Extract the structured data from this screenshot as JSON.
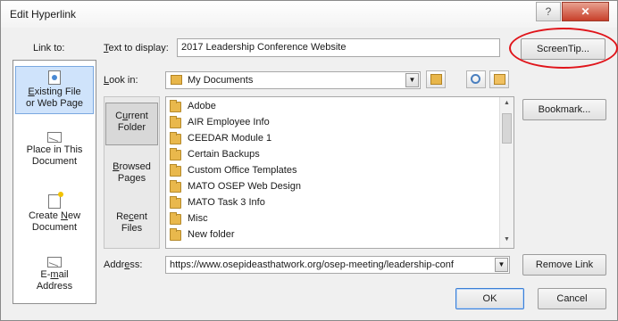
{
  "window": {
    "title": "Edit Hyperlink",
    "help_glyph": "?",
    "close_glyph": "✕"
  },
  "labels": {
    "link_to_prefix": "Link to:",
    "text_to_display_u": "T",
    "text_to_display_rest": "ext to display:",
    "look_in_u": "L",
    "look_in_rest": "ook in:",
    "address_prefix": "Addr",
    "address_u": "e",
    "address_rest": "ss:"
  },
  "text_to_display_value": "2017 Leadership Conference Website",
  "look_in_value": "My Documents",
  "address_value": "https://www.osepideasthatwork.org/osep-meeting/leadership-conf",
  "link_to": [
    {
      "line1_u": "E",
      "line1_rest": "xisting File",
      "line2": "or Web Page"
    },
    {
      "line1": "Place in This",
      "line2": "Document"
    },
    {
      "line1_pre": "Create ",
      "line1_u": "N",
      "line1_rest": "ew",
      "line2": "Document"
    },
    {
      "line1_pre": "E-",
      "line1_u": "m",
      "line1_rest": "ail",
      "line2": "Address"
    }
  ],
  "look_in_sections": [
    {
      "line1_pre": "C",
      "line1_u": "u",
      "line1_rest": "rrent",
      "line2": "Folder"
    },
    {
      "line1_u": "B",
      "line1_rest": "rowsed",
      "line2": "Pages"
    },
    {
      "line1_pre": "Re",
      "line1_u": "c",
      "line1_rest": "ent",
      "line2": "Files"
    }
  ],
  "files": [
    "Adobe",
    "AIR Employee Info",
    "CEEDAR Module 1",
    "Certain Backups",
    "Custom Office Templates",
    "MATO OSEP Web Design",
    "MATO Task 3 Info",
    "Misc",
    "New folder"
  ],
  "buttons": {
    "screentip": "ScreenTip...",
    "bookmark": "Bookmark...",
    "remove_link": "Remove Link",
    "ok": "OK",
    "cancel": "Cancel"
  },
  "glyphs": {
    "dropdown": "▼",
    "scroll_up": "▲",
    "scroll_down": "▼"
  },
  "colors": {
    "highlight_ring": "#e0141a",
    "selection": "#cfe3fb",
    "close_button": "#c8402a"
  }
}
